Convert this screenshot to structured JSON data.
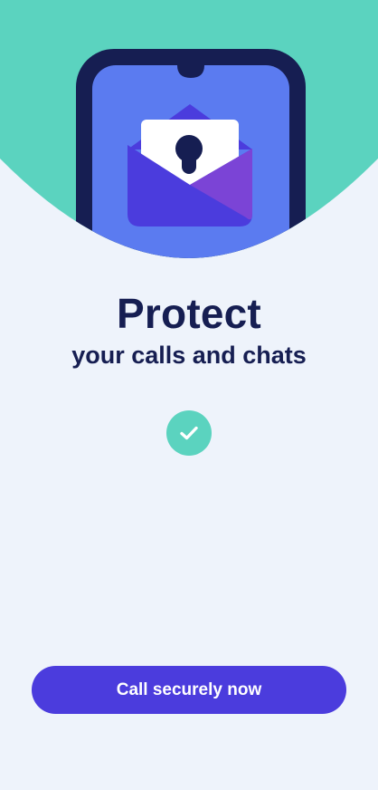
{
  "onboarding": {
    "title": "Protect",
    "subtitle": "your calls and chats",
    "cta_label": "Call securely now",
    "hero_icon": "phone-with-locked-envelope-illustration",
    "status_icon": "checkmark-icon"
  },
  "colors": {
    "background": "#EEF3FB",
    "hero_background": "#5BD3BF",
    "phone_frame": "#161E52",
    "phone_screen": "#5B7BF0",
    "envelope": "#4B3CDD",
    "envelope_flap": "#7B44D6",
    "text_primary": "#161E52",
    "check_badge": "#5BD3BF",
    "cta_background": "#4B3CDD",
    "cta_text": "#FFFFFF"
  }
}
